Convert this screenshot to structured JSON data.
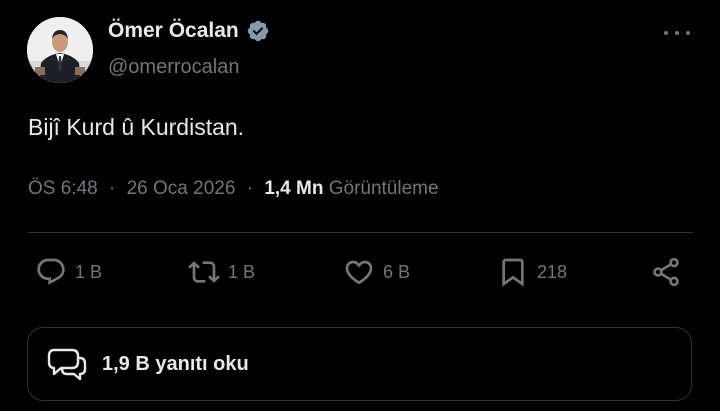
{
  "author": {
    "display_name": "Ömer Öcalan",
    "handle": "@omerrocalan",
    "verified_icon": "verified-badge-icon"
  },
  "tweet": {
    "text": "Bijî Kurd û Kurdistan."
  },
  "meta": {
    "time": "ÖS 6:48",
    "separator1": "·",
    "date": "26 Oca 2026",
    "separator2": "·",
    "views_count": "1,4 Mn",
    "views_label": "Görüntüleme"
  },
  "actions": {
    "replies": "1 B",
    "reposts": "1 B",
    "likes": "6 B",
    "bookmarks": "218"
  },
  "read_replies": {
    "label": "1,9 B yanıtı oku"
  },
  "colors": {
    "background": "#000000",
    "text_primary": "#e7e9ea",
    "text_secondary": "#71767b",
    "divider": "#2f3336",
    "verified_badge": "#829aab"
  }
}
